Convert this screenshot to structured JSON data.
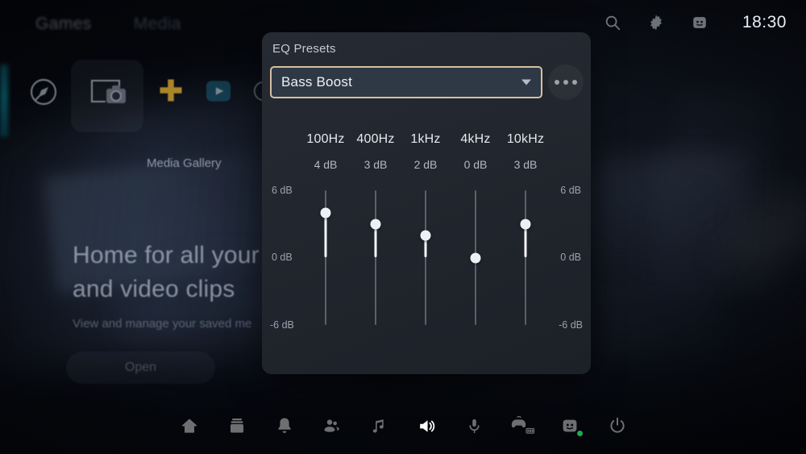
{
  "window": {
    "clock": "18:30"
  },
  "topnav": {
    "tabs": [
      {
        "label": "Games"
      },
      {
        "label": "Media"
      }
    ],
    "icons": [
      {
        "name": "search-icon"
      },
      {
        "name": "gear-icon"
      },
      {
        "name": "profile-avatar-icon"
      }
    ]
  },
  "gallery": {
    "tiles": [
      {
        "name": "explore-icon"
      },
      {
        "name": "media-gallery-icon"
      },
      {
        "name": "ps-plus-icon"
      },
      {
        "name": "ps-video-icon"
      }
    ],
    "selected_label": "Media Gallery"
  },
  "hero": {
    "line1": "Home for all your s",
    "line2": "and video clips",
    "subtitle": "View and manage your saved me",
    "button_label": "Open"
  },
  "eq": {
    "title": "EQ Presets",
    "preset_selected": "Bass Boost",
    "more_button_label": "More options",
    "scale": {
      "top_left": "6 dB",
      "top_right": "6 dB",
      "mid_left": "0 dB",
      "mid_right": "0 dB",
      "bottom_left": "-6 dB",
      "bottom_right": "-6 dB"
    },
    "accent_border": "#d6c0a2",
    "field_bg": "#2f3844",
    "bands": [
      {
        "freq": "100Hz",
        "value_label": "4 dB",
        "value": 4
      },
      {
        "freq": "400Hz",
        "value_label": "3 dB",
        "value": 3
      },
      {
        "freq": "1kHz",
        "value_label": "2 dB",
        "value": 2
      },
      {
        "freq": "4kHz",
        "value_label": "0 dB",
        "value": 0
      },
      {
        "freq": "10kHz",
        "value_label": "3 dB",
        "value": 3
      }
    ],
    "range": {
      "min": -6,
      "max": 6
    }
  },
  "taskbar": {
    "items": [
      {
        "name": "home-icon",
        "active": false
      },
      {
        "name": "library-icon",
        "active": false
      },
      {
        "name": "notifications-bell-icon",
        "active": false
      },
      {
        "name": "game-base-friends-icon",
        "active": false
      },
      {
        "name": "music-note-icon",
        "active": false
      },
      {
        "name": "volume-speaker-icon",
        "active": true
      },
      {
        "name": "microphone-icon",
        "active": false
      },
      {
        "name": "controller-battery-icon",
        "active": false
      },
      {
        "name": "profile-avatar-icon",
        "active": false
      },
      {
        "name": "power-icon",
        "active": false
      }
    ]
  }
}
